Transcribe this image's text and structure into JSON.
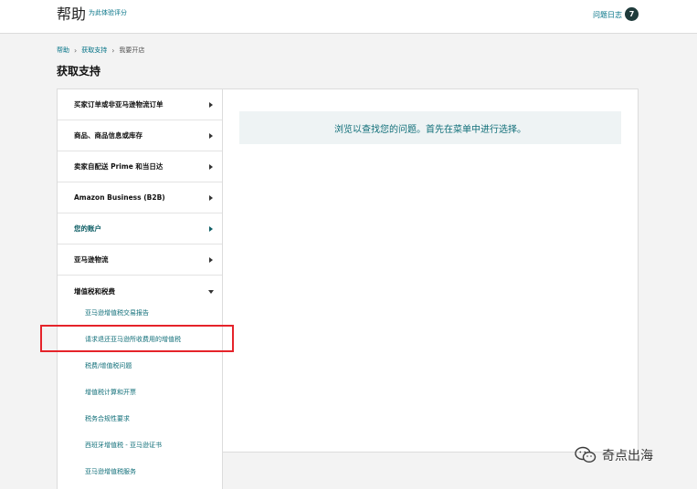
{
  "header": {
    "title": "帮助",
    "subtitle": "为此体验评分",
    "log_label": "问题日志",
    "log_count": "7"
  },
  "breadcrumb": {
    "items": [
      "帮助",
      "获取支持",
      "我要开店"
    ]
  },
  "page_title": "获取支持",
  "sidebar": {
    "items": [
      {
        "label": "买家订单或非亚马逊物流订单",
        "expanded": false
      },
      {
        "label": "商品、商品信息或库存",
        "expanded": false
      },
      {
        "label": "卖家自配送 Prime 和当日达",
        "expanded": false
      },
      {
        "label": "Amazon Business (B2B)",
        "expanded": false
      },
      {
        "label": "您的账户",
        "expanded": false
      },
      {
        "label": "亚马逊物流",
        "expanded": false
      },
      {
        "label": "增值税和税费",
        "expanded": true
      }
    ],
    "subitems": [
      "亚马逊增值税交易报告",
      "请求退还亚马逊所收费用的增值税",
      "税费/增值税问题",
      "增值税计算和开票",
      "税务合规性要求",
      "西班牙增值税 - 亚马逊证书",
      "亚马逊增值税服务"
    ],
    "highlighted_subitem": "请求退还亚马逊所收费用的增值税"
  },
  "main": {
    "notice": "浏览以查找您的问题。首先在菜单中进行选择。"
  },
  "watermark": {
    "text": "奇点出海"
  },
  "colors": {
    "link": "#007185",
    "highlight": "#e5232a",
    "badge": "#1f3b3b"
  }
}
